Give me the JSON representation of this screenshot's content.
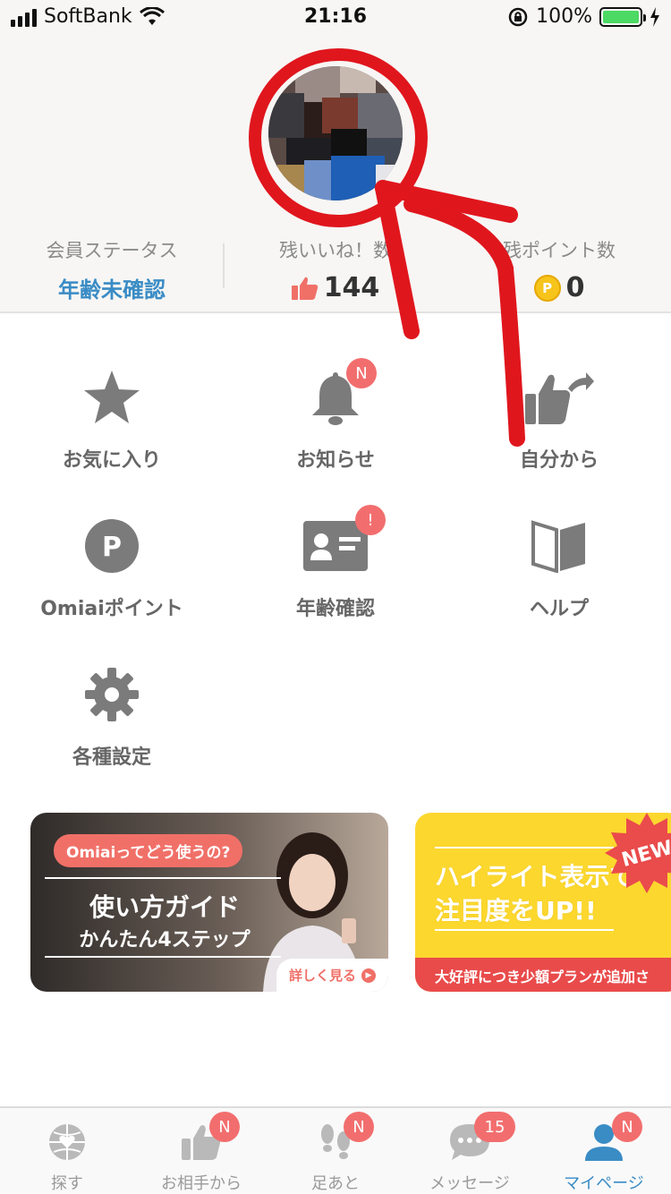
{
  "status_bar": {
    "carrier": "SoftBank",
    "time": "21:16",
    "battery_pct": "100%"
  },
  "profile": {
    "stats": [
      {
        "label": "会員ステータス",
        "value": "年齢未確認"
      },
      {
        "label": "残いいね！数",
        "value": "144"
      },
      {
        "label": "残ポイント数",
        "value": "0"
      }
    ],
    "coin_letter": "P"
  },
  "menu": {
    "items": [
      {
        "label": "お気に入り",
        "icon": "star-icon"
      },
      {
        "label": "お知らせ",
        "icon": "bell-icon",
        "badge": "N"
      },
      {
        "label": "自分から",
        "icon": "thumbs-up-share-icon"
      },
      {
        "label": "Omiaiポイント",
        "icon": "points-icon",
        "icon_letter": "P"
      },
      {
        "label": "年齢確認",
        "icon": "id-card-icon",
        "badge": "!"
      },
      {
        "label": "ヘルプ",
        "icon": "book-icon"
      },
      {
        "label": "各種設定",
        "icon": "gear-icon"
      }
    ]
  },
  "banners": {
    "guide": {
      "pill": "Omiaiってどう使うの?",
      "title": "使い方ガイド",
      "subtitle": "かんたん4ステップ",
      "more": "詳しく見る"
    },
    "highlight": {
      "title_line1": "ハイライト表示で",
      "title_line2": "注目度をUP!!",
      "bar": "大好評につき少額プランが追加さ",
      "new": "NEW"
    }
  },
  "tabs": [
    {
      "label": "探す",
      "icon": "globe-heart-icon"
    },
    {
      "label": "お相手から",
      "icon": "thumbs-up-icon",
      "badge": "N"
    },
    {
      "label": "足あと",
      "icon": "footprints-icon",
      "badge": "N"
    },
    {
      "label": "メッセージ",
      "icon": "chat-bubble-icon",
      "badge": "15"
    },
    {
      "label": "マイページ",
      "icon": "person-icon",
      "badge": "N",
      "active": true
    }
  ],
  "colors": {
    "accent_blue": "#3a8cc5",
    "badge_red": "#f26e6e",
    "annotation_red": "#e0161d",
    "icon_gray": "#7b7b7b"
  }
}
